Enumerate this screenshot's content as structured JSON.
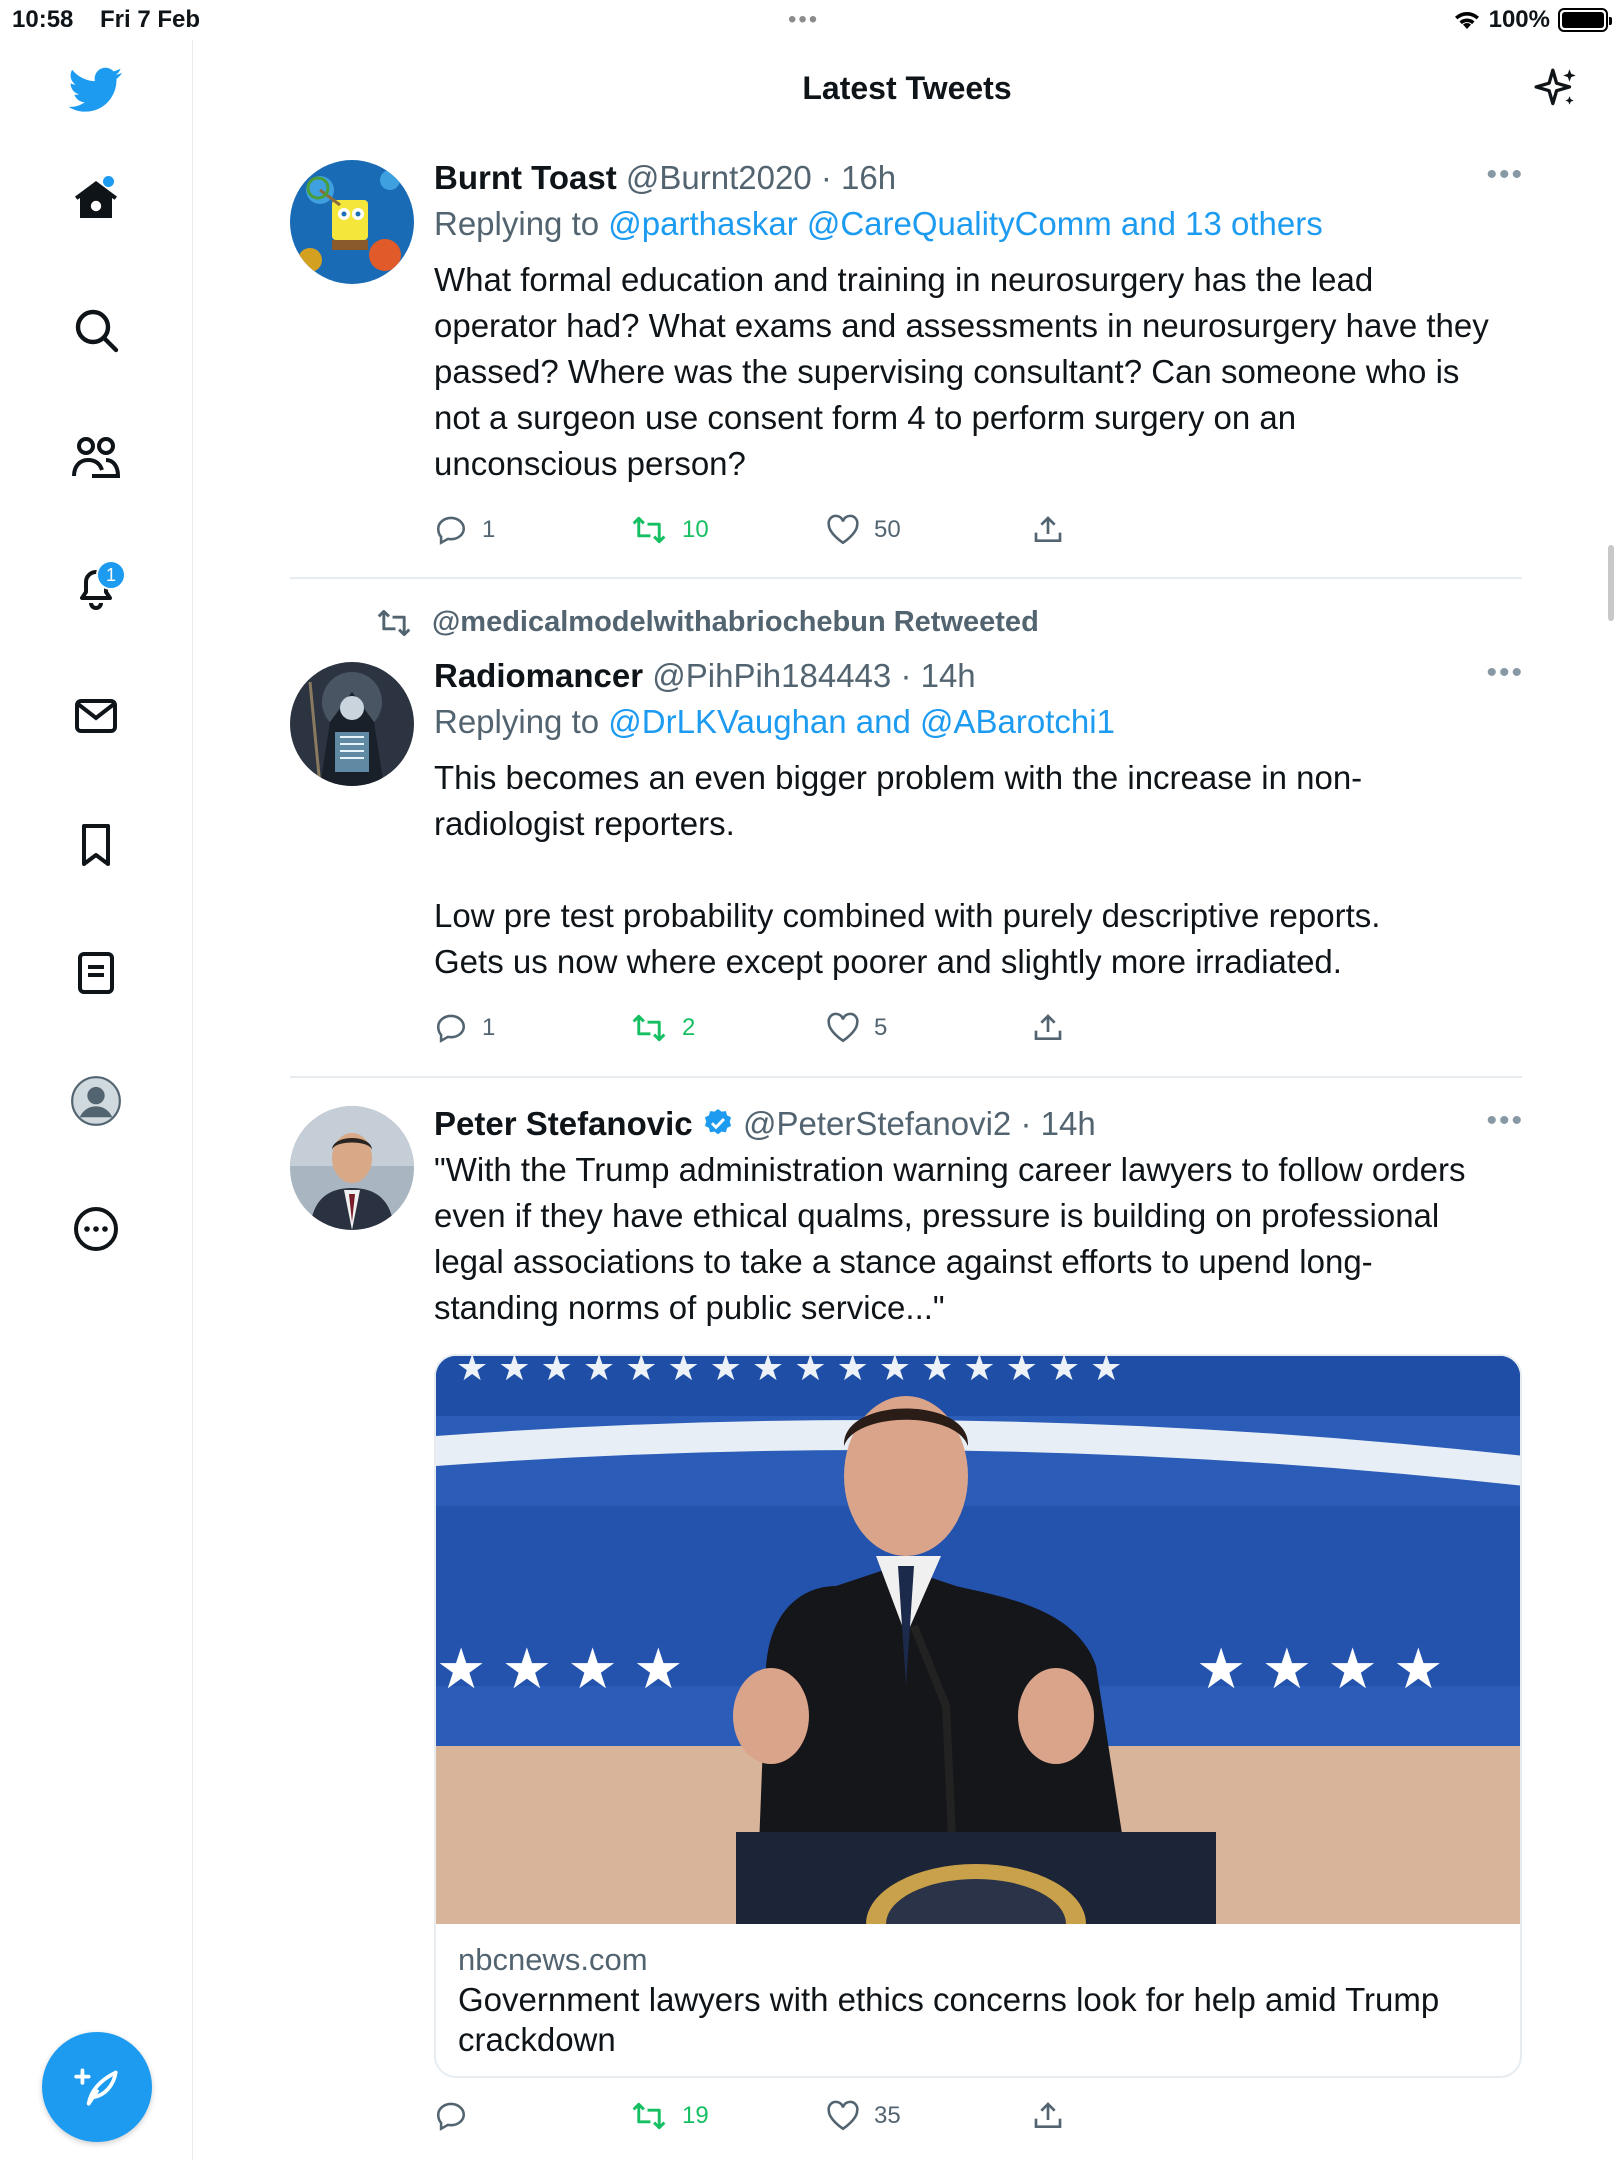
{
  "status_bar": {
    "time": "10:58",
    "date": "Fri 7 Feb",
    "battery": "100%"
  },
  "header": {
    "title": "Latest Tweets"
  },
  "sidebar": {
    "notification_count": "1"
  },
  "tweets": [
    {
      "name": "Burnt Toast",
      "handle": "@Burnt2020",
      "time": "· 16h",
      "replying_prefix": "Replying to ",
      "replying_to": "@parthaskar @CareQualityComm and 13 others",
      "body": "What formal education and training in neurosurgery has the lead\noperator had? What exams and assessments in neurosurgery have they\npassed? Where was the supervising consultant? Can someone who is\nnot a surgeon use consent form 4 to perform surgery on an\nunconscious person?",
      "replies": "1",
      "retweets": "10",
      "likes": "50"
    },
    {
      "retweeted_by": "@medicalmodelwithabriochebun Retweeted",
      "name": "Radiomancer",
      "handle": "@PihPih184443",
      "time": "· 14h",
      "replying_prefix": "Replying to ",
      "replying_to": "@DrLKVaughan and @ABarotchi1",
      "body": "This becomes an even bigger problem with the increase in non-\nradiologist reporters.\n\nLow pre test probability combined with purely descriptive reports.\nGets us now where except poorer and slightly more irradiated.",
      "replies": "1",
      "retweets": "2",
      "likes": "5"
    },
    {
      "name": "Peter Stefanovic",
      "handle": "@PeterStefanovi2",
      "time": "· 14h",
      "body": "\"With the Trump administration warning career lawyers to follow orders\neven if they have ethical qualms, pressure is building on professional\nlegal associations to take a stance against efforts to upend long-\nstanding norms of public service...\"",
      "card": {
        "domain": "nbcnews.com",
        "title": "Government lawyers with ethics concerns look for help amid Trump\ncrackdown"
      },
      "retweets": "19",
      "likes": "35"
    }
  ],
  "icons": {
    "logo": "twitter-bird-icon",
    "home": "home-icon",
    "search": "search-icon",
    "communities": "people-icon",
    "notifications": "bell-icon",
    "messages": "envelope-icon",
    "bookmarks": "bookmark-icon",
    "lists": "list-icon",
    "profile": "profile-icon",
    "more": "more-circle-icon",
    "compose": "compose-icon",
    "sparkle": "sparkle-icon"
  },
  "colors": {
    "brand": "#1d9bf0",
    "retweet_green": "#17bf63",
    "muted": "#536471"
  }
}
